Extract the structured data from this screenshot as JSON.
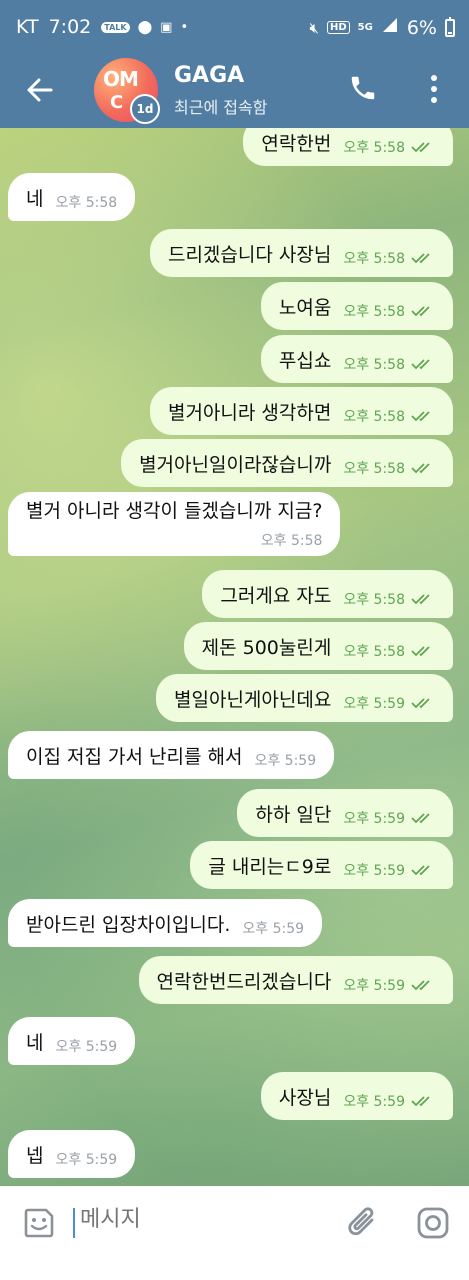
{
  "status_bar": {
    "carrier": "KT",
    "time": "7:02",
    "app_badge": "TALK",
    "battery": "6%",
    "network_hd": "HD",
    "network_gen": "5G"
  },
  "header": {
    "title": "GAGA",
    "subtitle": "최근에 접속함",
    "avatar_text_top": "OM",
    "avatar_text_bottom": "C",
    "avatar_badge": "1d"
  },
  "messages": [
    {
      "dir": "out",
      "text": "연락한번",
      "time": "오후 5:58"
    },
    {
      "dir": "in",
      "text": "네",
      "time": "오후 5:58"
    },
    {
      "dir": "out",
      "text": "드리겠습니다 사장님",
      "time": "오후 5:58"
    },
    {
      "dir": "out",
      "text": "노여움",
      "time": "오후 5:58"
    },
    {
      "dir": "out",
      "text": "푸십쇼",
      "time": "오후 5:58"
    },
    {
      "dir": "out",
      "text": "별거아니라 생각하면",
      "time": "오후 5:58"
    },
    {
      "dir": "out",
      "text": "별거아닌일이라잖습니까",
      "time": "오후 5:58"
    },
    {
      "dir": "in",
      "text": "별거 아니라 생각이 들겠습니까 지금?",
      "time": "오후 5:58"
    },
    {
      "dir": "out",
      "text": "그러게요 자도",
      "time": "오후 5:58"
    },
    {
      "dir": "out",
      "text": "제돈 500눌린게",
      "time": "오후 5:58"
    },
    {
      "dir": "out",
      "text": "별일아닌게아닌데요",
      "time": "오후 5:59"
    },
    {
      "dir": "in",
      "text": "이집 저집 가서 난리를 해서",
      "time": "오후 5:59"
    },
    {
      "dir": "out",
      "text": "하하 일단",
      "time": "오후 5:59"
    },
    {
      "dir": "out",
      "text": "글 내리는ㄷ9로",
      "time": "오후 5:59"
    },
    {
      "dir": "in",
      "text": "받아드린 입장차이입니다.",
      "time": "오후 5:59"
    },
    {
      "dir": "out",
      "text": "연락한번드리겠습니다",
      "time": "오후 5:59"
    },
    {
      "dir": "in",
      "text": "네",
      "time": "오후 5:59"
    },
    {
      "dir": "out",
      "text": "사장님",
      "time": "오후 5:59"
    },
    {
      "dir": "in",
      "text": "넵",
      "time": "오후 5:59"
    }
  ],
  "composer": {
    "placeholder": "메시지"
  },
  "colors": {
    "header": "#527da3",
    "outgoing_bubble": "#effdde",
    "incoming_bubble": "#ffffff",
    "read_check": "#5fa653"
  },
  "icons": {
    "back": "arrow-left-icon",
    "call": "phone-icon",
    "more": "more-vertical-icon",
    "emoji": "emoji-icon",
    "attach": "paperclip-icon",
    "camera": "camera-icon"
  }
}
